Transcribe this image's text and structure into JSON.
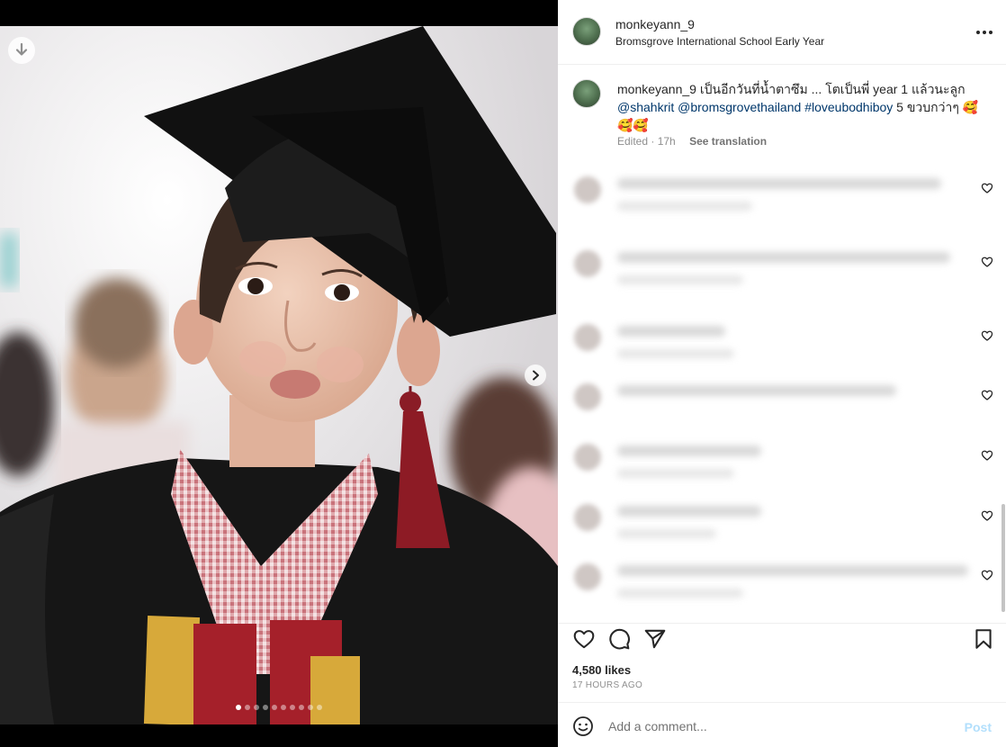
{
  "post": {
    "username": "monkeyann_9",
    "location": "Bromsgrove International School Early Year",
    "more_icon": "more-horizontal-icon"
  },
  "caption": {
    "username": "monkeyann_9",
    "text_1": "เป็นอีกวันที่น้ำตาซึม ... โตเป็นพี่ year 1 แล้วนะลูก",
    "mention_1": "@shahkrit",
    "mention_2": "@bromsgrovethailand",
    "hashtag": "#loveubodhiboy",
    "text_2": "5 ขวบกว่าๆ",
    "emoji_1": "🥰",
    "emoji_2": "🥰🥰",
    "edited": "Edited · 17h",
    "see_translation": "See translation"
  },
  "photo": {
    "carousel_count": 10,
    "active_index": 0,
    "download_icon": "download-icon",
    "next_icon": "chevron-right-icon"
  },
  "actions": {
    "like_icon": "heart-icon",
    "comment_icon": "comment-icon",
    "share_icon": "send-icon",
    "save_icon": "bookmark-icon"
  },
  "stats": {
    "likes": "4,580 likes",
    "posted": "17 HOURS AGO"
  },
  "comment_box": {
    "placeholder": "Add a comment...",
    "post_label": "Post"
  },
  "colors": {
    "link": "#00376b",
    "post_disabled": "#b2dffc",
    "gown": "#1a1a1a",
    "sash_gold": "#d7a93a",
    "sash_red": "#a5202a"
  }
}
